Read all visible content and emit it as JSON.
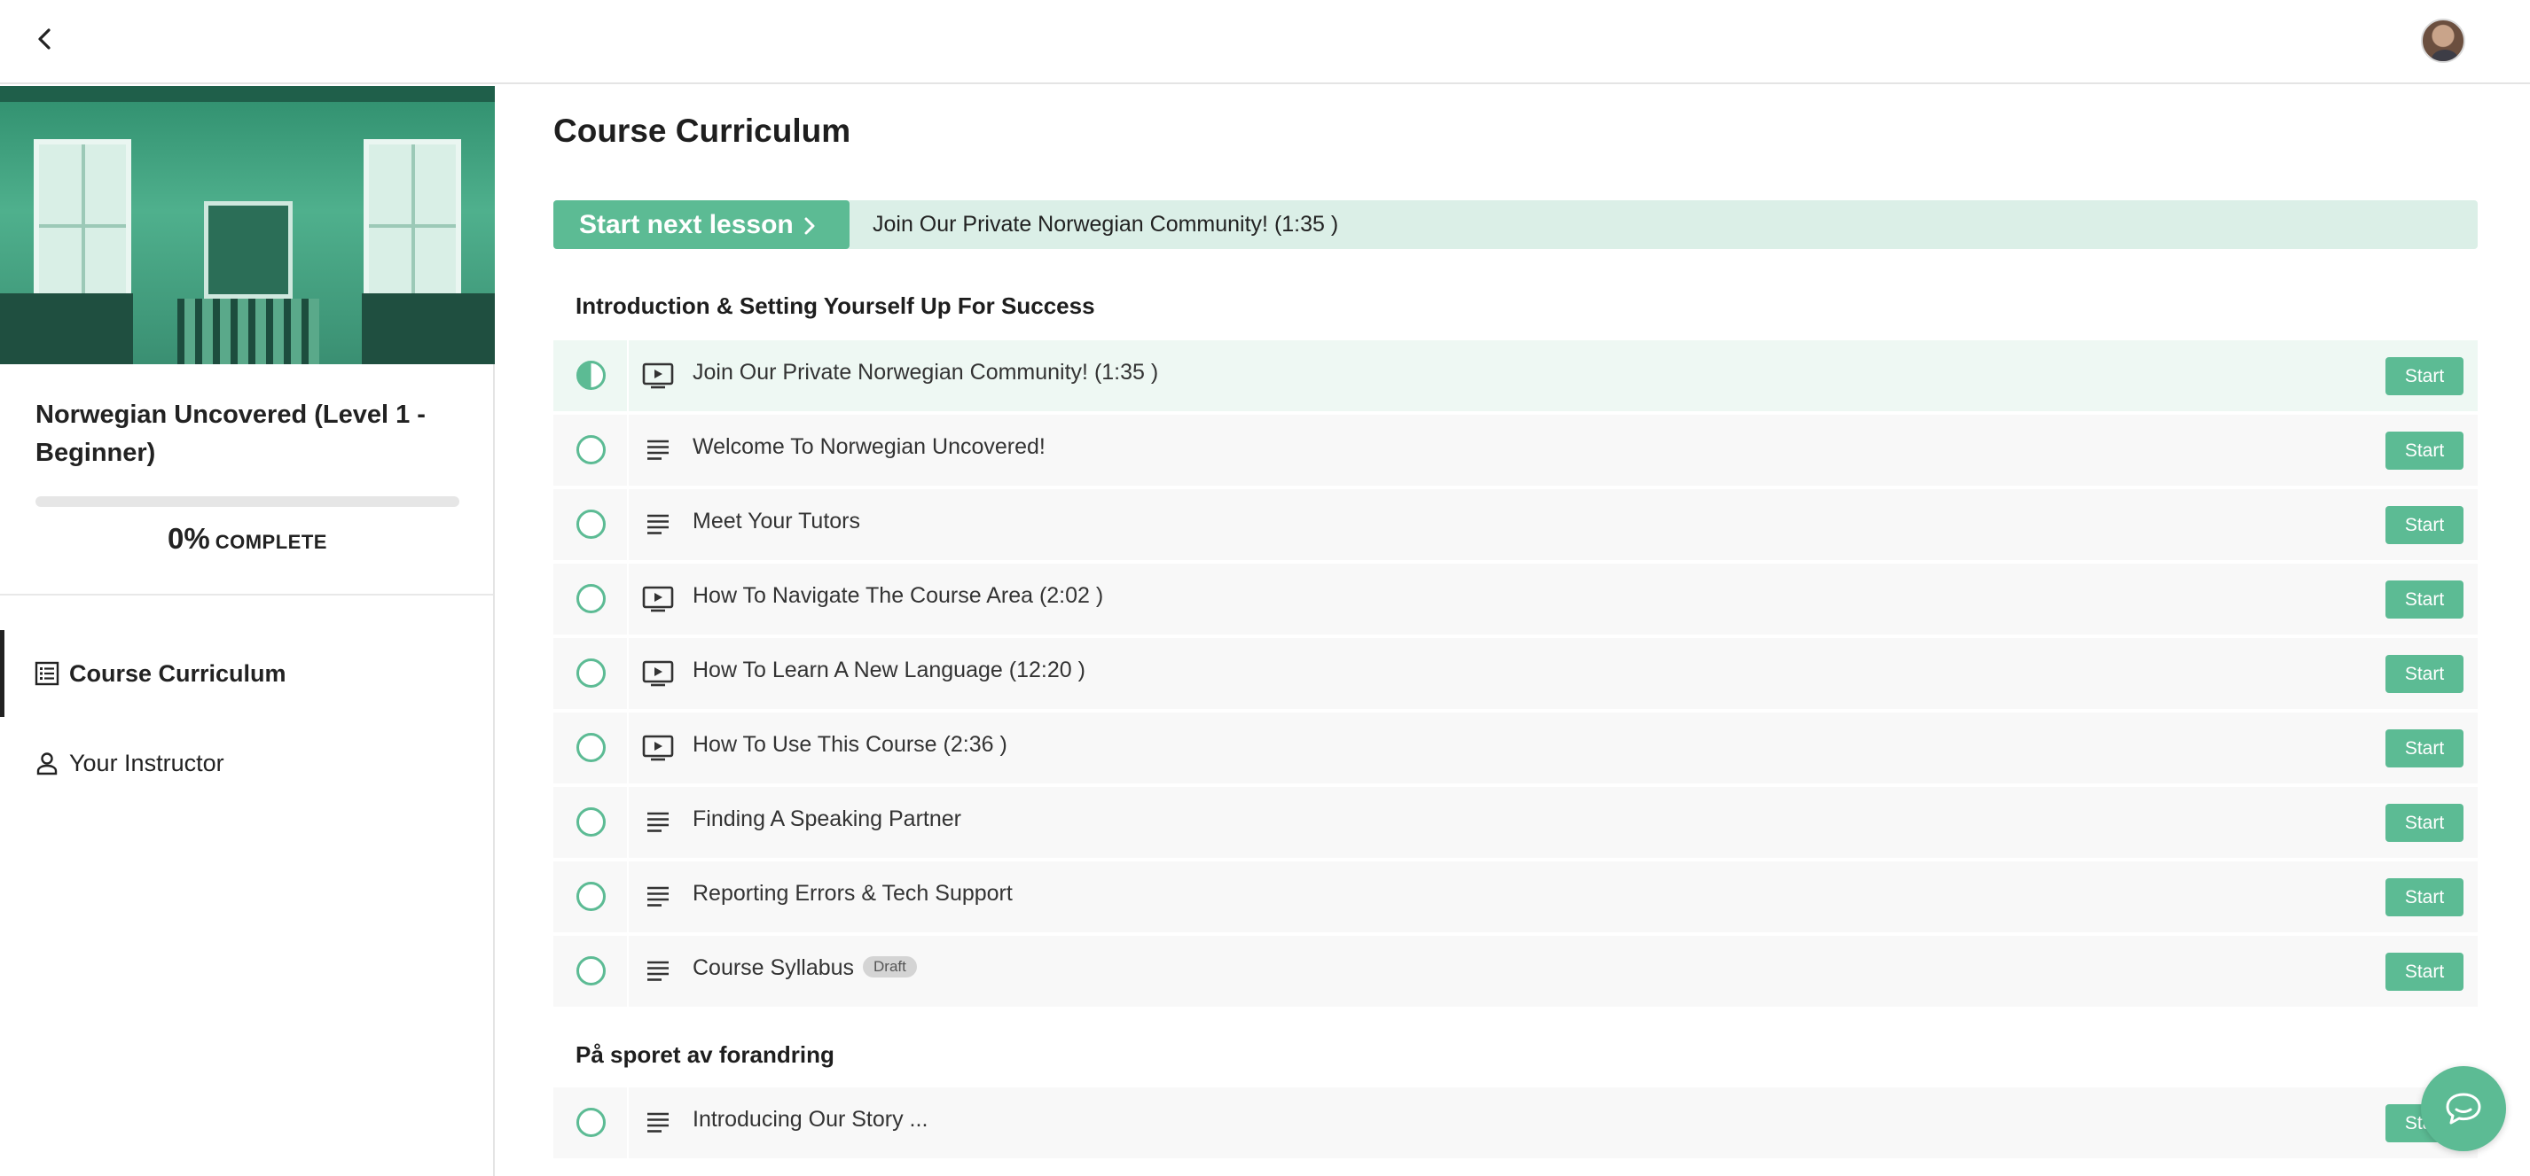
{
  "colors": {
    "accent": "#5cbb94",
    "accent_light": "#dbefe7"
  },
  "header": {
    "back_icon": "chevron-left-icon",
    "avatar_icon": "user-avatar"
  },
  "sidebar": {
    "course_title": "Norwegian Uncovered (Level 1 - Beginner)",
    "progress": {
      "percent_value": 0,
      "percent": "0%",
      "label": "COMPLETE"
    },
    "nav": [
      {
        "label": "Course Curriculum",
        "icon": "list-icon",
        "active": true
      },
      {
        "label": "Your Instructor",
        "icon": "person-icon",
        "active": false
      }
    ]
  },
  "main": {
    "title": "Course Curriculum",
    "next_lesson": {
      "button_label": "Start next lesson",
      "lesson_title": "Join Our Private Norwegian Community! (1:35 )"
    },
    "sections": [
      {
        "title": "Introduction & Setting Yourself Up For Success",
        "lessons": [
          {
            "title": "Join Our Private Norwegian Community! (1:35 )",
            "type": "video",
            "status": "in-progress",
            "action": "Start"
          },
          {
            "title": "Welcome To Norwegian Uncovered!",
            "type": "text",
            "status": "not-started",
            "action": "Start"
          },
          {
            "title": "Meet Your Tutors",
            "type": "text",
            "status": "not-started",
            "action": "Start"
          },
          {
            "title": "How To Navigate The Course Area (2:02 )",
            "type": "video",
            "status": "not-started",
            "action": "Start"
          },
          {
            "title": "How To Learn A New Language (12:20 )",
            "type": "video",
            "status": "not-started",
            "action": "Start"
          },
          {
            "title": "How To Use This Course (2:36 )",
            "type": "video",
            "status": "not-started",
            "action": "Start"
          },
          {
            "title": "Finding A Speaking Partner",
            "type": "text",
            "status": "not-started",
            "action": "Start"
          },
          {
            "title": "Reporting Errors & Tech Support",
            "type": "text",
            "status": "not-started",
            "action": "Start"
          },
          {
            "title": "Course Syllabus",
            "type": "text",
            "status": "not-started",
            "action": "Start",
            "badge": "Draft"
          }
        ]
      },
      {
        "title": "På sporet av forandring",
        "lessons": [
          {
            "title": "Introducing Our Story ...",
            "type": "text",
            "status": "not-started",
            "action": "Start"
          }
        ]
      }
    ]
  },
  "chat": {
    "icon": "chat-icon"
  }
}
